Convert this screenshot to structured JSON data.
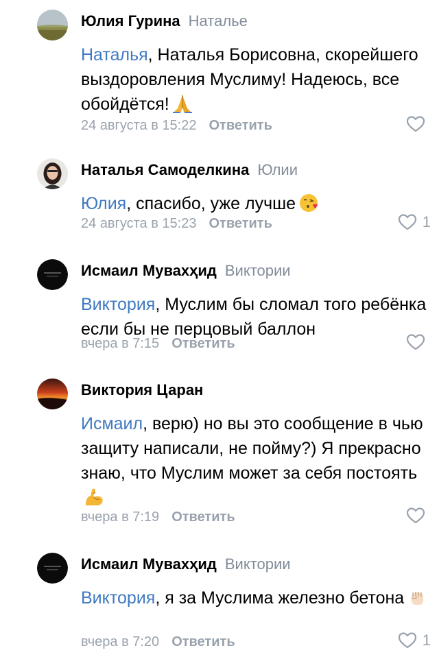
{
  "comments": [
    {
      "author": "Юлия Гурина",
      "reply_to": "Наталье",
      "mention": "Наталья",
      "text": ", Наталья Борисовна, скорейшего выздоровления Муслиму! Надеюсь, все обойдётся!",
      "emoji": "praying-hands",
      "time": "24 августа в 15:22",
      "reply_label": "Ответить",
      "likes": ""
    },
    {
      "author": "Наталья Самоделкина",
      "reply_to": "Юлии",
      "mention": "Юлия",
      "text": ", спасибо, уже лучше",
      "emoji": "face-blowing-kiss",
      "time": "24 августа в 15:23",
      "reply_label": "Ответить",
      "likes": "1"
    },
    {
      "author": "Исмаил Мувахҳид",
      "reply_to": "Виктории",
      "mention": "Виктория",
      "text": ", Муслим бы сломал того ребёнка если бы не перцовый баллон",
      "emoji": "",
      "time": "вчера в 7:15",
      "reply_label": "Ответить",
      "likes": ""
    },
    {
      "author": "Виктория Царан",
      "reply_to": "",
      "mention": "Исмаил",
      "text": ", верю) но вы это сообщение в чью защиту написали, не пойму?) Я прекрасно знаю, что Муслим может за себя постоять",
      "emoji": "flexed-biceps",
      "time": "вчера в 7:19",
      "reply_label": "Ответить",
      "likes": ""
    },
    {
      "author": "Исмаил Мувахҳид",
      "reply_to": "Виктории",
      "mention": "Виктория",
      "text": ", я за Муслима железно бетона",
      "emoji": "raised-fist",
      "time": "вчера в 7:20",
      "reply_label": "Ответить",
      "likes": "1"
    }
  ],
  "colors": {
    "mention": "#3f7ac1",
    "muted": "#99a2ad",
    "reply_to": "#818c99"
  }
}
